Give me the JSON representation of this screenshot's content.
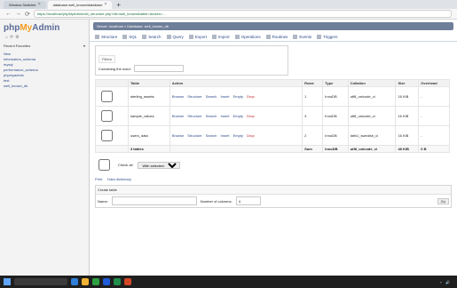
{
  "browser": {
    "tabs": [
      {
        "label": "Window Switcher",
        "active": false
      },
      {
        "label": "database.well_known/database",
        "active": true
      }
    ],
    "url": "https://localhost/phpMyAdmin/db_structure.php?db=well_known&table=&token=..."
  },
  "sidebar": {
    "logo_php": "php",
    "logo_my": "My",
    "logo_admin": "Admin",
    "recent_label": "Recent   Favorites",
    "tree": [
      "New",
      "information_schema",
      "mysql",
      "performance_schema",
      "phpmyadmin",
      "test",
      "well_known_db"
    ]
  },
  "content": {
    "breadcrumb": "Server: localhost » Database: well_known_db",
    "toolbar": [
      {
        "label": "Structure",
        "icon": "table-icon"
      },
      {
        "label": "SQL",
        "icon": "sql-icon"
      },
      {
        "label": "Search",
        "icon": "search-icon"
      },
      {
        "label": "Query",
        "icon": "query-icon"
      },
      {
        "label": "Export",
        "icon": "export-icon"
      },
      {
        "label": "Import",
        "icon": "import-icon"
      },
      {
        "label": "Operations",
        "icon": "gear-icon"
      },
      {
        "label": "Routines",
        "icon": "routine-icon"
      },
      {
        "label": "Events",
        "icon": "clock-icon"
      },
      {
        "label": "Triggers",
        "icon": "trigger-icon"
      }
    ],
    "filters": {
      "legend": "Filters",
      "containing": "Containing the word:",
      "placeholder": ""
    },
    "table": {
      "headers": [
        "",
        "Table",
        "Action",
        "Rows",
        "Type",
        "Collation",
        "Size",
        "Overhead"
      ],
      "rows": [
        {
          "name": "sterling_assets",
          "rows": "1",
          "type": "InnoDB",
          "collation": "utf8_unicode_ci",
          "size": "16 KiB",
          "overhead": "-"
        },
        {
          "name": "sample_values",
          "rows": "3",
          "type": "InnoDB",
          "collation": "utf8_unicode_ci",
          "size": "16 KiB",
          "overhead": "-"
        },
        {
          "name": "users_data",
          "rows": "2",
          "type": "InnoDB",
          "collation": "latin1_swedish_ci",
          "size": "16 KiB",
          "overhead": "-"
        }
      ],
      "footer": {
        "label": "3 tables",
        "rows": "Sum",
        "type": "InnoDB",
        "collation": "utf8_unicode_ci",
        "size": "48 KiB",
        "overhead": "0 B"
      }
    },
    "bulk": {
      "check_all": "Check all",
      "with_selected": "With selected:"
    },
    "links": {
      "print": "Print",
      "dictionary": "Data dictionary"
    },
    "create": {
      "header": "Create table",
      "name_label": "Name:",
      "columns_label": "Number of columns:",
      "columns_value": "4",
      "go": "Go"
    }
  }
}
